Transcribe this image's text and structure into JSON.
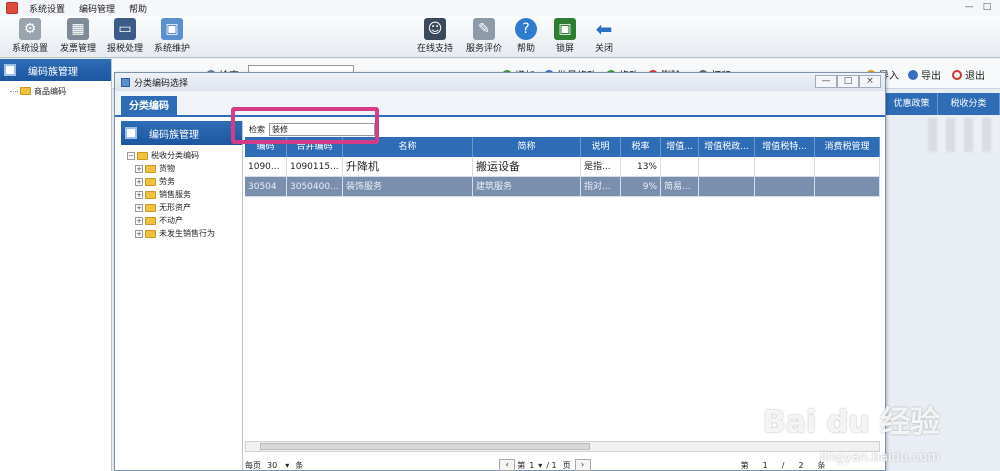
{
  "menu": [
    "系统设置",
    "编码管理",
    "帮助"
  ],
  "window_controls": [
    "—",
    "□"
  ],
  "toolbar_left": [
    {
      "label": "系统设置",
      "icon": "gear-icon",
      "color": "#9aa4ae"
    },
    {
      "label": "发票管理",
      "icon": "invoice-icon",
      "color": "#7e8a97"
    },
    {
      "label": "报税处理",
      "icon": "monitor-icon",
      "color": "#3c5b87"
    },
    {
      "label": "系统维护",
      "icon": "maintenance-icon",
      "color": "#5b8fd0"
    }
  ],
  "toolbar_right": [
    {
      "label": "在线支持",
      "icon": "support-icon",
      "color": "#3a4a5c"
    },
    {
      "label": "服务评价",
      "icon": "rating-icon",
      "color": "#8d9aa8"
    },
    {
      "label": "帮助",
      "icon": "help-icon",
      "color": "#2f7bd0"
    },
    {
      "label": "锁屏",
      "icon": "lock-screen-icon",
      "color": "#2e7d32"
    },
    {
      "label": "关闭",
      "icon": "close-arrow-icon",
      "color": "#2a6fc0"
    }
  ],
  "left_pane": {
    "title": "编码族管理",
    "tree_root": "商品编码"
  },
  "main_bar": {
    "search_label": "检索",
    "items": [
      {
        "label": "增加",
        "color": "#3a9a3a"
      },
      {
        "label": "批量修改",
        "color": "#3a6fc0"
      },
      {
        "label": "修改",
        "color": "#3a9a3a"
      },
      {
        "label": "删除",
        "color": "#d03030"
      },
      {
        "label": "打印",
        "color": "#666666"
      },
      {
        "label": "导入",
        "color": "#e0a020"
      },
      {
        "label": "导出",
        "color": "#3a6fc0"
      },
      {
        "label": "退出",
        "color": "#d03030"
      }
    ],
    "bg_columns": [
      "优惠政策",
      "税收分类"
    ]
  },
  "dialog": {
    "title": "分类编码选择",
    "controls": [
      "—",
      "□",
      "×"
    ],
    "tab": "分类编码",
    "tree_title": "编码族管理",
    "tree_root": "税收分类编码",
    "tree_items": [
      "货物",
      "劳务",
      "销售服务",
      "无形资产",
      "不动产",
      "未发生销售行为"
    ],
    "search_label": "检索",
    "search_value": "装修",
    "columns": [
      "编码",
      "合并编码",
      "名称",
      "简称",
      "说明",
      "税率",
      "增值...",
      "增值税政...",
      "增值税特...",
      "消费税管理"
    ],
    "rows": [
      [
        "1090...",
        "1090115...",
        "升降机",
        "搬运设备",
        "是指...",
        "13%",
        "",
        "",
        "",
        ""
      ],
      [
        "30504",
        "3050400...",
        "装饰服务",
        "建筑服务",
        "指对...",
        "9%",
        "简易...",
        "",
        "",
        ""
      ]
    ],
    "pager": {
      "per_page_label": "每页",
      "per_page": "30",
      "unit": "条",
      "page_label_pre": "第",
      "page": "1",
      "page_total": "/ 1",
      "page_label_post": "页",
      "right_pre": "第",
      "right_a": "1",
      "right_sep": "/",
      "right_b": "2",
      "right_unit": "条"
    }
  },
  "watermark": {
    "main": "Bai du 经验",
    "sub": "jingyan.baidu.com"
  },
  "colors": {
    "accent": "#2e6db5",
    "highlight": "#d33c86",
    "selected_row": "#7a8fae"
  }
}
